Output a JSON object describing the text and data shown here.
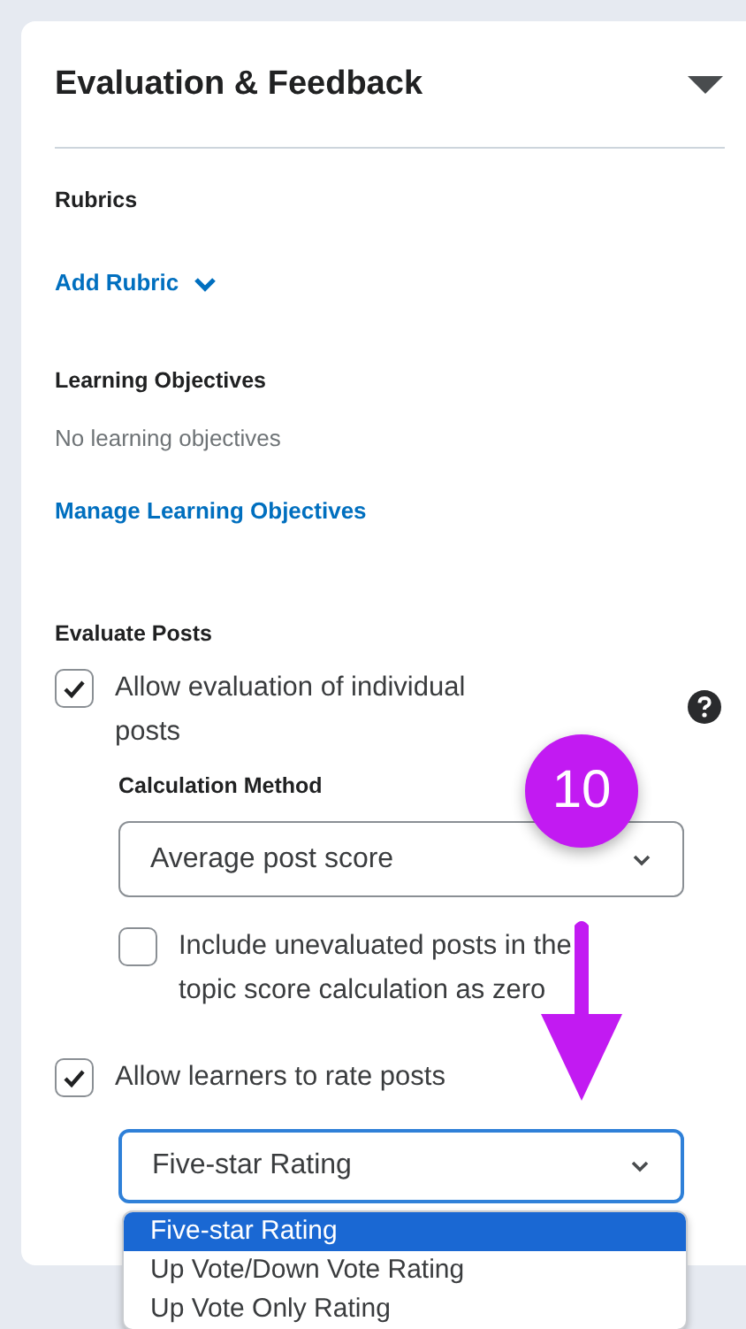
{
  "section": {
    "title": "Evaluation & Feedback",
    "expanded": true
  },
  "rubrics": {
    "heading": "Rubrics",
    "link": "Add Rubric"
  },
  "objectives": {
    "heading": "Learning Objectives",
    "empty_text": "No learning objectives",
    "link": "Manage Learning Objectives"
  },
  "evaluate": {
    "heading": "Evaluate Posts",
    "allow_evaluation": {
      "label": "Allow evaluation of individual posts",
      "checked": true
    },
    "calculation_label": "Calculation Method",
    "calculation_select": {
      "value": "Average post score"
    },
    "include_unevaluated": {
      "label": "Include unevaluated posts in the topic score calculation as zero",
      "checked": false
    },
    "allow_rating": {
      "label": "Allow learners to rate posts",
      "checked": true
    },
    "rating_select": {
      "value": "Five-star Rating",
      "open": true,
      "options": [
        {
          "label": "Five-star Rating",
          "selected": true
        },
        {
          "label": "Up Vote/Down Vote Rating",
          "selected": false
        },
        {
          "label": "Up Vote Only Rating",
          "selected": false
        }
      ]
    }
  },
  "annotation": {
    "step": "10"
  }
}
